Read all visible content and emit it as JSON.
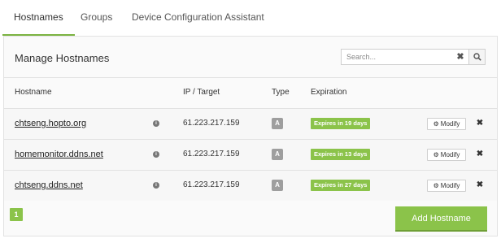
{
  "tabs": [
    {
      "label": "Hostnames",
      "active": true
    },
    {
      "label": "Groups",
      "active": false
    },
    {
      "label": "Device Configuration Assistant",
      "active": false
    }
  ],
  "panel": {
    "title": "Manage Hostnames",
    "search_placeholder": "Search...",
    "search_value": ""
  },
  "table": {
    "headers": [
      "Hostname",
      "IP / Target",
      "Type",
      "Expiration"
    ],
    "rows": [
      {
        "hostname": "chtseng.hopto.org",
        "ip": "61.223.217.159",
        "type": "A",
        "expiration": "Expires in 19 days",
        "modify_label": "Modify"
      },
      {
        "hostname": "homemonitor.ddns.net",
        "ip": "61.223.217.159",
        "type": "A",
        "expiration": "Expires in 13 days",
        "modify_label": "Modify"
      },
      {
        "hostname": "chtseng.ddns.net",
        "ip": "61.223.217.159",
        "type": "A",
        "expiration": "Expires in 27 days",
        "modify_label": "Modify"
      }
    ]
  },
  "pagination": {
    "current_page": "1"
  },
  "add_button_label": "Add Hostname",
  "colors": {
    "accent": "#8bc34a",
    "tab_underline": "#7cb342"
  }
}
